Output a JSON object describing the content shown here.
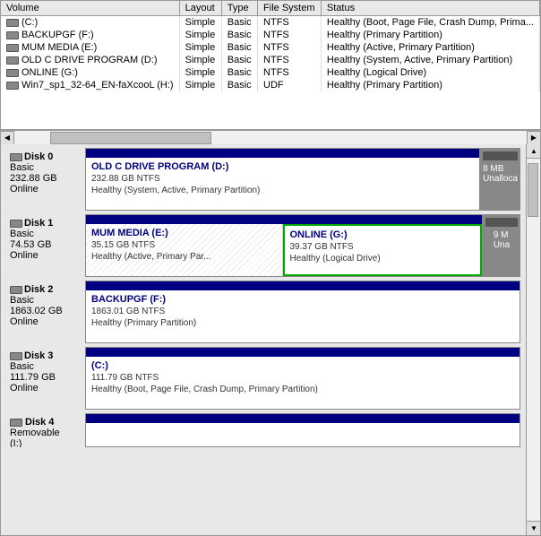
{
  "table": {
    "columns": [
      "Volume",
      "Layout",
      "Type",
      "File System",
      "Status"
    ],
    "column_widths": [
      "200px",
      "60px",
      "50px",
      "80px",
      "auto"
    ],
    "rows": [
      {
        "volume": "(C:)",
        "layout": "Simple",
        "type": "Basic",
        "fs": "NTFS",
        "status": "Healthy (Boot, Page File, Crash Dump, Prima..."
      },
      {
        "volume": "BACKUPGF (F:)",
        "layout": "Simple",
        "type": "Basic",
        "fs": "NTFS",
        "status": "Healthy (Primary Partition)"
      },
      {
        "volume": "MUM MEDIA (E:)",
        "layout": "Simple",
        "type": "Basic",
        "fs": "NTFS",
        "status": "Healthy (Active, Primary Partition)"
      },
      {
        "volume": "OLD C DRIVE PROGRAM (D:)",
        "layout": "Simple",
        "type": "Basic",
        "fs": "NTFS",
        "status": "Healthy (System, Active, Primary Partition)"
      },
      {
        "volume": "ONLINE (G:)",
        "layout": "Simple",
        "type": "Basic",
        "fs": "NTFS",
        "status": "Healthy (Logical Drive)"
      },
      {
        "volume": "Win7_sp1_32-64_EN-faXcooL (H:)",
        "layout": "Simple",
        "type": "Basic",
        "fs": "UDF",
        "status": "Healthy (Primary Partition)"
      }
    ]
  },
  "disks": [
    {
      "id": "disk0",
      "label": "Disk 0",
      "type": "Basic",
      "size": "232.88 GB",
      "status": "Online",
      "partitions": [
        {
          "name": "OLD C DRIVE PROGRAM  (D:)",
          "size": "232.88 GB NTFS",
          "health": "Healthy (System, Active, Primary Partition)",
          "flex": 10,
          "hatched": false,
          "selected": false
        }
      ],
      "unalloc": "8 MB\nUnalloca"
    },
    {
      "id": "disk1",
      "label": "Disk 1",
      "type": "Basic",
      "size": "74.53 GB",
      "status": "Online",
      "partitions": [
        {
          "name": "MUM MEDIA  (E:)",
          "size": "35.15 GB NTFS",
          "health": "Healthy (Active, Primary Par...",
          "flex": 5,
          "hatched": true,
          "selected": false
        },
        {
          "name": "ONLINE  (G:)",
          "size": "39.37 GB NTFS",
          "health": "Healthy (Logical Drive)",
          "flex": 5,
          "hatched": false,
          "selected": true
        }
      ],
      "unalloc": "9 M\nUna"
    },
    {
      "id": "disk2",
      "label": "Disk 2",
      "type": "Basic",
      "size": "1863.02 GB",
      "status": "Online",
      "partitions": [
        {
          "name": "BACKUPGF  (F:)",
          "size": "1863.01 GB NTFS",
          "health": "Healthy (Primary Partition)",
          "flex": 10,
          "hatched": false,
          "selected": false
        }
      ],
      "unalloc": null
    },
    {
      "id": "disk3",
      "label": "Disk 3",
      "type": "Basic",
      "size": "111.79 GB",
      "status": "Online",
      "partitions": [
        {
          "name": "(C:)",
          "size": "111.79 GB NTFS",
          "health": "Healthy (Boot, Page File, Crash Dump, Primary Partition)",
          "flex": 10,
          "hatched": false,
          "selected": false
        }
      ],
      "unalloc": null
    },
    {
      "id": "disk4",
      "label": "Disk 4",
      "type": "Removable",
      "size": "(I:)",
      "status": "",
      "partitions": [],
      "unalloc": null
    }
  ]
}
